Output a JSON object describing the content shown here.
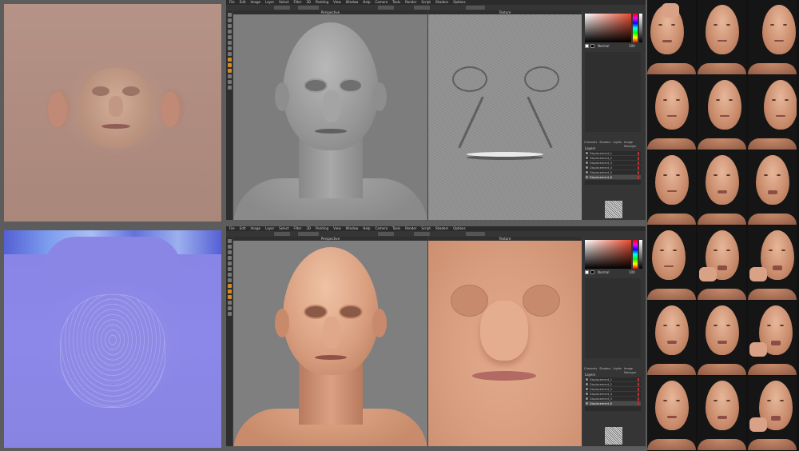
{
  "textures": {
    "diffuse_name": "diffuse-texture",
    "normal_name": "normal-map"
  },
  "app_top": {
    "menu": [
      "File",
      "Edit",
      "Image",
      "Layer",
      "Select",
      "Filter",
      "3D",
      "Painting",
      "View",
      "Window",
      "Help",
      "Camera",
      "Tools",
      "Render",
      "Script",
      "Shaders",
      "Options"
    ],
    "viewport3d_label": "Perspective",
    "viewport2d_label": "Texture",
    "panel": {
      "tabs": [
        "Channels",
        "Shaders",
        "Lights",
        "Image Manager"
      ],
      "layers_header": "Layers",
      "layers": [
        "Displacement_1",
        "Displacement_2",
        "Displacement_3",
        "Displacement_4",
        "Displacement_5",
        "Displacement_6"
      ],
      "selected_layer": 5,
      "mode_label": "Normal",
      "opacity_label": "100"
    }
  },
  "app_bot": {
    "menu": [
      "File",
      "Edit",
      "Image",
      "Layer",
      "Select",
      "Filter",
      "3D",
      "Painting",
      "View",
      "Window",
      "Help",
      "Camera",
      "Tools",
      "Render",
      "Script",
      "Shaders",
      "Options"
    ],
    "viewport3d_label": "Perspective",
    "viewport2d_label": "Texture",
    "panel": {
      "tabs": [
        "Channels",
        "Shaders",
        "Lights",
        "Image Manager"
      ],
      "layers_header": "Layers",
      "layers": [
        "Displacement_1",
        "Displacement_2",
        "Displacement_3",
        "Displacement_4",
        "Displacement_5",
        "Displacement_6"
      ],
      "selected_layer": 5,
      "mode_label": "Normal",
      "opacity_label": "100"
    }
  },
  "colors": {
    "ui_dark": "#3d3d3d",
    "skin": "#d9a27f",
    "clay": "#8f8f8f",
    "normal_blue": "#8c88e6",
    "accent_orange": "#d58a2a"
  },
  "photos": [
    "photo-1",
    "photo-2",
    "photo-3",
    "photo-4",
    "photo-5",
    "photo-6",
    "photo-7",
    "photo-8",
    "photo-9",
    "photo-10",
    "photo-11",
    "photo-12",
    "photo-13",
    "photo-14",
    "photo-15",
    "photo-16",
    "photo-17",
    "photo-18"
  ]
}
